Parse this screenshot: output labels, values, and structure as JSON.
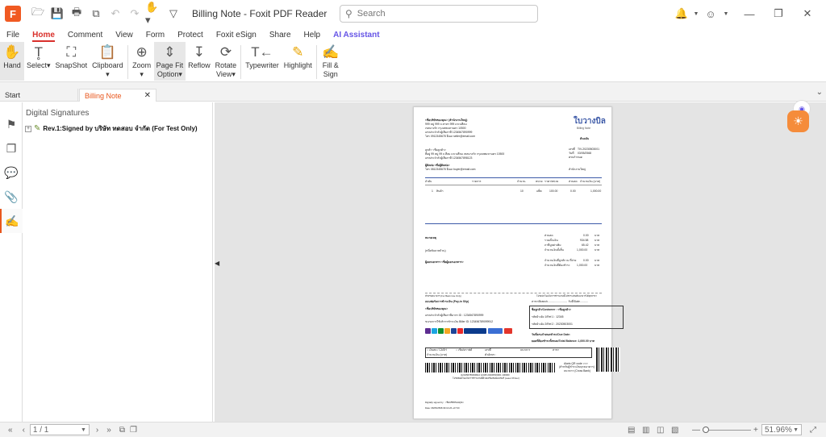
{
  "window": {
    "title": "Billing Note - Foxit PDF Reader",
    "logo": "F"
  },
  "search": {
    "placeholder": "Search"
  },
  "menu": [
    "File",
    "Home",
    "Comment",
    "View",
    "Form",
    "Protect",
    "Foxit eSign",
    "Share",
    "Help",
    "AI Assistant"
  ],
  "ribbon": {
    "hand": "Hand",
    "select": "Select",
    "snapshot": "SnapShot",
    "clipboard": "Clipboard",
    "zoom": "Zoom",
    "pagefit1": "Page Fit",
    "pagefit2": "Option",
    "reflow": "Reflow",
    "rotate1": "Rotate",
    "rotate2": "View",
    "typewriter": "Typewriter",
    "highlight": "Highlight",
    "fill1": "Fill &",
    "fill2": "Sign"
  },
  "tabs": {
    "start": "Start",
    "current": "Billing Note"
  },
  "panel": {
    "title": "Digital Signatures",
    "item": "Rev.1:Signed by บริษัท ทดสอบ จำกัด (For Test Only)"
  },
  "doc": {
    "company": "<ชื่อบริษัทของคุณ> (สำนักงานใหญ่)",
    "addr1": "999 หมู่ 999 ถ.สาทร 999 แขวงสีลม",
    "addr2": "เขตบางรัก กรุงเทพมหานคร 10500",
    "taxid": "เลขประจำตัวผู้เสียภาษี 1234567890999",
    "phone": "โทร 0912345678 อีเมล seller@email.com",
    "doctitle": "ใบวางบิล",
    "docsub": "Billing Note",
    "original": "ต้นฉบับ",
    "customer": "ลูกค้า <ชื่อลูกค้า>",
    "caddr": "ที่อยู่ 99 หมู่ 99 ถ.สีลม แขวงสีลม เขตบางรัก กรุงเทพมหานคร 10500",
    "ctax": "เลขประจำตัวผู้เสียภาษี 1234567898123",
    "contact": "ผู้ติดต่อ <ชื่อผู้ติดต่อ>",
    "cphone": "โทร 0812345678 อีเมล buyer@email.com",
    "docno_label": "เลขที่",
    "docno": "TIV-20230503001",
    "date_label": "วันที่",
    "date": "03/05/2568",
    "due_label": "ครบกำหนด",
    "due": "",
    "branch": "สำนักงานใหญ่",
    "cols": [
      "ลำดับ",
      "รายการ",
      "จำนวน",
      "หน่วย",
      "ราคา/หน่วย",
      "ส่วนลด",
      "จำนวนเงิน (บาท)"
    ],
    "row": [
      "1",
      "สินค้า",
      "10",
      "แพ็ค",
      "100.00",
      "0.00",
      "1,000.00"
    ],
    "remark": "หมายเหตุ",
    "totals": [
      [
        "ส่วนลด",
        "0.00",
        "บาท"
      ],
      [
        "รวมเป็นเงิน",
        "934.58",
        "บาท"
      ],
      [
        "ภาษีมูลค่าเพิ่ม",
        "65.42",
        "บาท"
      ],
      [
        "จำนวนเงินทั้งสิ้น",
        "1,000.00",
        "บาท"
      ]
    ],
    "words": "(หนึ่งพันบาทถ้วน)",
    "wht": [
      [
        "จำนวนเงินที่ถูกหัก ณ ที่จ่าย",
        "0.00",
        "บาท"
      ],
      [
        "จำนวนเงินที่ต้องชำระ",
        "1,000.00",
        "บาท"
      ]
    ],
    "issuer": "ผู้ออกเอกสาร <ชื่อผู้ออกเอกสาร>",
    "slip_left": "สำหรับธนาคาร (For Bank Use Only)",
    "slip_right": "โปรดนำใบแจ้งการชำระเงินนี้ไปชำระเงินที่ธนาคารได้ทุกสาขา",
    "paytitle": "แบบฟอร์มการชำระเงิน (Pay-in Slip)",
    "branch_line": "สาขา/Branch..........................  วันที่/Date...........",
    "paycomp": "<ชื่อบริษัทของคุณ>",
    "paytax": "เลขประจำตัวผู้เสียภาษีอากร ID : 1234567890999",
    "paybiller": "ขนาดการใช้บริการชำระเงิน Biller ID: 123456789099912",
    "cust_box": "ชื่อลูกค้า/Customer : <ชื่อลูกค้า>",
    "ref1": "รหัสอ้างอิง 1/Ref.1 : 12345",
    "ref2": "รหัสอ้างอิง 2/Ref.2 : 20230503001",
    "duedate": "วันที่ครบกำหนดชำระ/Due Date:",
    "balance": "ยอดที่ต้องชำระทั้งหมด/Total Balance: 1,000.00 บาท",
    "cash": "เงินสด / CASH",
    "cheque": "เช็ค/ดราฟต์",
    "chqno": "เลขที่",
    "bankname": "ธนาคาร",
    "bankbranch": "สาขา",
    "amount_label": "จำนวนเงิน (บาท)",
    "words_label": "ตัวอักษร :",
    "qr_text1": "Alaris QR code >>>",
    "qr_text2": "(สำหรับผู้ชำระเงินทุกธนาคาร)",
    "qr_text3": "ธนาคาร (Cross Bank)",
    "barcode_text": "|123456789099912 12345 20230503001 100000",
    "barcode_note": "โปรดพิมพ์ใบแจ้งการชำระเงินนี้ด้วยเครื่องพิมพ์เลเซอร์ (Laser Printer)",
    "signed": "Digitally signed by : <ชื่อบริษัทของคุณ>",
    "signdate": "Date: 08/05/2568 09:13:26 +07:00"
  },
  "status": {
    "page": "1 / 1",
    "zoom": "51.96%"
  }
}
